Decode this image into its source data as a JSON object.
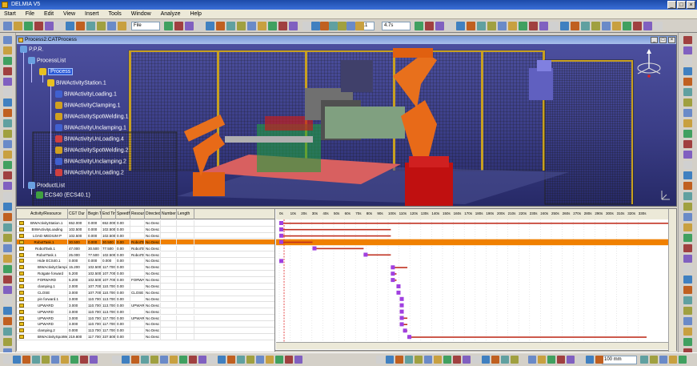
{
  "app": {
    "title": "DELMIA V5",
    "window_controls": [
      "_",
      "□",
      "×"
    ]
  },
  "menu": {
    "items": [
      "Start",
      "File",
      "Edit",
      "View",
      "Insert",
      "Tools",
      "Window",
      "Analyze",
      "Help"
    ]
  },
  "toolbar": {
    "file_combo": "File",
    "step_value": "0.1",
    "time_value": "4.7s"
  },
  "document": {
    "title": "Process2.CATProcess",
    "controls": [
      "_",
      "□",
      "×"
    ]
  },
  "tree": {
    "nodes": [
      {
        "label": "P.P.R.",
        "icon_color": "#6aa0e0",
        "selected": false
      },
      {
        "label": "ProcessList",
        "icon_color": "#6aa0e0",
        "selected": false
      },
      {
        "label": "Process",
        "icon_color": "#e8c020",
        "selected": true
      },
      {
        "label": "BIWActivityStation.1",
        "icon_color": "#e8c020",
        "selected": false
      },
      {
        "label": "BIWActivityLoading.1",
        "icon_color": "#4060d0",
        "selected": false
      },
      {
        "label": "BIWActivityClamping.1",
        "icon_color": "#d0a020",
        "selected": false
      },
      {
        "label": "BIWActivitySpotWelding.1",
        "icon_color": "#d0a020",
        "selected": false
      },
      {
        "label": "BIWActivityUnclamping.1",
        "icon_color": "#4060d0",
        "selected": false
      },
      {
        "label": "BIWActivityUnLoading.4",
        "icon_color": "#d04040",
        "selected": false
      },
      {
        "label": "BIWActivitySpotWelding.2",
        "icon_color": "#d0a020",
        "selected": false
      },
      {
        "label": "BIWActivityUnclamping.2",
        "icon_color": "#4060d0",
        "selected": false
      },
      {
        "label": "BIWActivityUnLoading.2",
        "icon_color": "#d04040",
        "selected": false
      },
      {
        "label": "ProductList",
        "icon_color": "#6aa0e0",
        "selected": false
      },
      {
        "label": "ECS40 (ECS40.1)",
        "icon_color": "#40a040",
        "selected": false
      }
    ]
  },
  "sheet": {
    "columns": [
      "Activity/Resource",
      "CGT Dur",
      "Begin Ti",
      "End Tim",
      "Speedfac",
      "Resourc",
      "Directed",
      "Number",
      "Length"
    ],
    "rows": [
      {
        "cells": [
          "BIWActivityStation.1",
          "652.000",
          "0.000",
          "652.000",
          "0.00",
          "",
          "No Desc",
          "",
          ""
        ],
        "highlight": false
      },
      {
        "cells": [
          "BIWActivityLoading",
          "102.500",
          "0.000",
          "102.500",
          "0.00",
          "",
          "No Desc",
          "",
          ""
        ],
        "highlight": false
      },
      {
        "cells": [
          "LOAD MEDIUM P",
          "102.500",
          "0.000",
          "102.500",
          "0.00",
          "",
          "No Desc",
          "",
          ""
        ],
        "highlight": false
      },
      {
        "cells": [
          "RobotTask.1",
          "30.500",
          "0.000",
          "30.500",
          "0.00",
          "RobotTa",
          "No Desc",
          "",
          ""
        ],
        "highlight": true
      },
      {
        "cells": [
          "RobotTask.1",
          "47.000",
          "30.500",
          "77.500",
          "0.00",
          "RobotTa",
          "No Desc",
          "",
          ""
        ],
        "highlight": false
      },
      {
        "cells": [
          "RobotTask.1",
          "25.000",
          "77.500",
          "102.500",
          "0.00",
          "RobotTa",
          "No Desc",
          "",
          ""
        ],
        "highlight": false
      },
      {
        "cells": [
          "Hide ECS40.1",
          "0.000",
          "0.000",
          "0.000",
          "0.00",
          "",
          "No Desc",
          "",
          ""
        ],
        "highlight": false
      },
      {
        "cells": [
          "BIWActivityClamping",
          "15.200",
          "102.500",
          "117.700",
          "0.00",
          "",
          "No Desc",
          "",
          ""
        ],
        "highlight": false
      },
      {
        "cells": [
          "Rotgate forward",
          "5.200",
          "102.500",
          "107.700",
          "0.00",
          "",
          "No Desc",
          "",
          ""
        ],
        "highlight": false
      },
      {
        "cells": [
          "FORWARD",
          "5.200",
          "102.500",
          "107.700",
          "0.00",
          "FORWA",
          "No Desc",
          "",
          ""
        ],
        "highlight": false
      },
      {
        "cells": [
          "clamping.1",
          "2.000",
          "107.700",
          "110.700",
          "0.00",
          "",
          "No Desc",
          "",
          ""
        ],
        "highlight": false
      },
      {
        "cells": [
          "CLOSE",
          "3.000",
          "107.700",
          "110.700",
          "0.00",
          "CLOSE",
          "No Desc",
          "",
          ""
        ],
        "highlight": false
      },
      {
        "cells": [
          "pin forward.1",
          "3.000",
          "110.700",
          "113.700",
          "0.00",
          "",
          "No Desc",
          "",
          ""
        ],
        "highlight": false
      },
      {
        "cells": [
          "UPWARD",
          "3.000",
          "110.700",
          "113.700",
          "0.00",
          "UPWAR",
          "No Desc",
          "",
          ""
        ],
        "highlight": false
      },
      {
        "cells": [
          "UPWARD",
          "3.000",
          "110.700",
          "113.700",
          "0.00",
          "",
          "No Desc",
          "",
          ""
        ],
        "highlight": false
      },
      {
        "cells": [
          "UPWARD",
          "3.000",
          "110.700",
          "117.700",
          "0.00",
          "UPWAR",
          "No Desc",
          "",
          ""
        ],
        "highlight": false
      },
      {
        "cells": [
          "UPWARD",
          "3.000",
          "110.700",
          "117.700",
          "0.00",
          "",
          "No Desc",
          "",
          ""
        ],
        "highlight": false
      },
      {
        "cells": [
          "clamping.2",
          "0.000",
          "113.700",
          "117.700",
          "0.00",
          "",
          "No Desc",
          "",
          ""
        ],
        "highlight": false
      },
      {
        "cells": [
          "BIWActivitySpotWel",
          "219.800",
          "117.700",
          "337.500",
          "0.00",
          "",
          "No Desc",
          "",
          ""
        ],
        "highlight": false
      }
    ]
  },
  "gantt": {
    "ticks": [
      "0s",
      "10s",
      "20s",
      "30s",
      "40s",
      "50s",
      "60s",
      "70s",
      "80s",
      "90s",
      "100s",
      "110s",
      "120s",
      "130s",
      "140s",
      "150s",
      "160s",
      "170s",
      "180s",
      "190s",
      "200s",
      "210s",
      "220s",
      "230s",
      "240s",
      "250s",
      "260s",
      "270s",
      "280s",
      "290s",
      "300s",
      "310s",
      "320s",
      "330s"
    ],
    "bar_color": "#c03020",
    "highlight_color": "#f08000",
    "marker_color": "#a040e0"
  },
  "statusbar": {
    "zoom": "100 mm"
  }
}
